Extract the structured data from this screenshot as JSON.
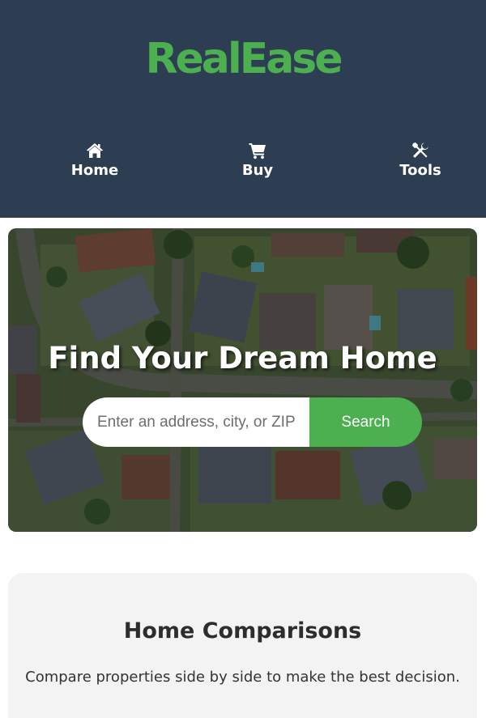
{
  "brand": {
    "name": "RealEase",
    "color": "#4caf50"
  },
  "header": {
    "background": "#2e3e52"
  },
  "nav": [
    {
      "label": "Home",
      "icon": "home-icon"
    },
    {
      "label": "Buy",
      "icon": "cart-icon"
    },
    {
      "label": "Tools",
      "icon": "tools-icon"
    }
  ],
  "hero": {
    "title": "Find Your Dream Home",
    "search": {
      "placeholder": "Enter an address, city, or ZIP code",
      "button_label": "Search"
    }
  },
  "feature": {
    "title": "Home Comparisons",
    "description": "Compare properties side by side to make the best decision."
  }
}
